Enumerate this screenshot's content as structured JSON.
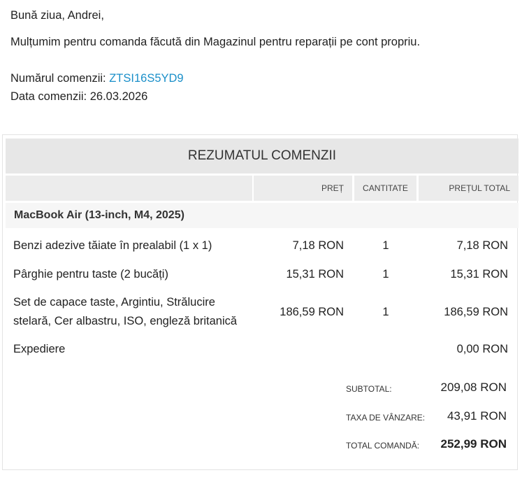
{
  "email": {
    "greeting": "Bună ziua, Andrei,",
    "thanks": "Mulțumim pentru comanda făcută din Magazinul pentru reparații pe cont propriu.",
    "order_number_label": "Numărul comenzii:",
    "order_number": "ZTSI16S5YD9",
    "order_date_label": "Data comenzii:",
    "order_date": "26.03.2026"
  },
  "summary": {
    "title": "REZUMATUL COMENZII",
    "columns": {
      "price": "PREȚ",
      "quantity": "CANTITATE",
      "total": "PREȚUL TOTAL"
    },
    "group_title": "MacBook Air (13-inch, M4, 2025)",
    "items": [
      {
        "name": "Benzi adezive tăiate în prealabil (1 x 1)",
        "price": "7,18 RON",
        "qty": "1",
        "total": "7,18 RON"
      },
      {
        "name": "Pârghie pentru taste (2 bucăți)",
        "price": "15,31 RON",
        "qty": "1",
        "total": "15,31 RON"
      },
      {
        "name_line1": "Set de capace taste, Argintiu, Strălucire",
        "name_line2": "stelară, Cer albastru, ISO, engleză britanică",
        "price": "186,59 RON",
        "qty": "1",
        "total": "186,59 RON"
      }
    ],
    "shipping": {
      "label": "Expediere",
      "total": "0,00 RON"
    },
    "totals": {
      "subtotal_label": "SUBTOTAL:",
      "subtotal": "209,08 RON",
      "tax_label": "TAXA DE VÂNZARE:",
      "tax": "43,91 RON",
      "grand_label": "TOTAL COMANDĂ:",
      "grand": "252,99 RON"
    }
  }
}
